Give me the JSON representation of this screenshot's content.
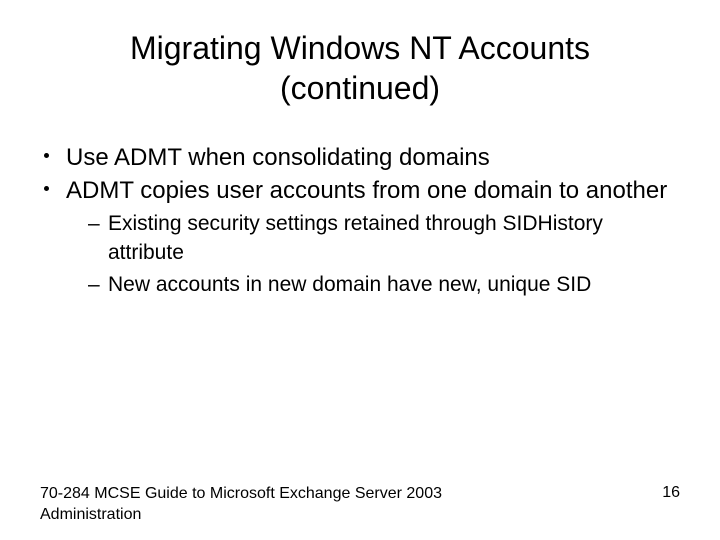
{
  "title": "Migrating Windows NT Accounts (continued)",
  "bullets": [
    {
      "text": "Use ADMT when consolidating domains"
    },
    {
      "text": "ADMT copies user accounts from one domain to another"
    }
  ],
  "subbullets": [
    {
      "text": "Existing security settings retained through SIDHistory attribute"
    },
    {
      "text": "New accounts in new domain have new, unique SID"
    }
  ],
  "footer": {
    "source": "70-284 MCSE Guide to Microsoft Exchange Server 2003 Administration",
    "page": "16"
  },
  "dash": "–"
}
